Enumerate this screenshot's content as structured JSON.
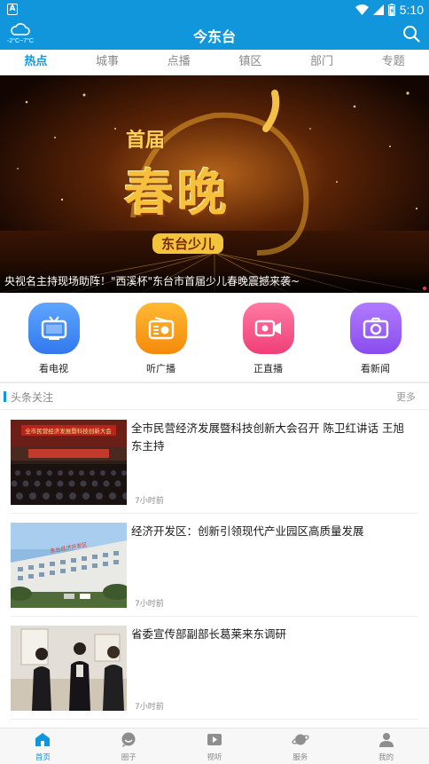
{
  "status_bar": {
    "time": "5:10",
    "app_icon": "A"
  },
  "header": {
    "weather": "-2°C~7°C",
    "title": "今东台"
  },
  "tabs": [
    "热点",
    "城事",
    "点播",
    "镇区",
    "部门",
    "专题"
  ],
  "banner": {
    "caption": "央视名主持现场助阵！\"西溪杯\"东台市首届少儿春晚震撼来袭~",
    "art_title_top": "首届",
    "art_title_main": "春晚",
    "art_title_sub": "东台少儿"
  },
  "quick_links": [
    {
      "label": "看电视",
      "icon": "tv-icon",
      "color": "#3d8bf3"
    },
    {
      "label": "听广播",
      "icon": "radio-icon",
      "color": "#f7a21a"
    },
    {
      "label": "正直播",
      "icon": "video-camera-icon",
      "color": "#f45b8a"
    },
    {
      "label": "看新闻",
      "icon": "camera-icon",
      "color": "#9b5cf0"
    }
  ],
  "section": {
    "label": "头条关注",
    "more": "更多"
  },
  "news": [
    {
      "title": "全市民营经济发展暨科技创新大会召开 陈卫红讲话 王旭东主持",
      "time": "7小时前",
      "thumb_banner": "全市民营经济发展暨科技创新大会"
    },
    {
      "title": "经济开发区：创新引领现代产业园区高质量发展",
      "time": "7小时前",
      "thumb_banner": "东台经济开发区"
    },
    {
      "title": "省委宣传部副部长葛莱来东调研",
      "time": "7小时前",
      "thumb_banner": ""
    }
  ],
  "bottom_nav": [
    {
      "label": "首页",
      "icon": "home-icon"
    },
    {
      "label": "圈子",
      "icon": "chat-icon"
    },
    {
      "label": "视听",
      "icon": "play-icon"
    },
    {
      "label": "服务",
      "icon": "planet-icon"
    },
    {
      "label": "我的",
      "icon": "person-icon"
    }
  ],
  "colors": {
    "primary": "#1296db",
    "text_muted": "#888888"
  }
}
